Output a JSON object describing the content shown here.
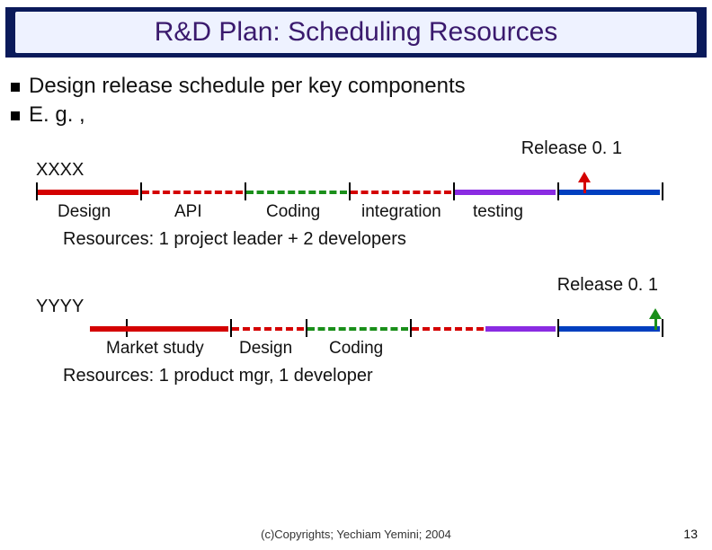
{
  "title": "R&D Plan: Scheduling Resources",
  "bullets": [
    "Design release schedule per key components",
    "E. g. ,"
  ],
  "timelines": [
    {
      "row_label": "XXXX",
      "release_label": "Release 0. 1",
      "segments": [
        {
          "label": "Design",
          "color": "#d40000",
          "style": "solid"
        },
        {
          "label": "API",
          "color": "#d40000",
          "style": "dash"
        },
        {
          "label": "Coding",
          "color": "#1a8f1a",
          "style": "dash"
        },
        {
          "label": "integration",
          "color": "#d40000",
          "style": "dash"
        },
        {
          "label": "testing",
          "color": "#8a2be2",
          "style": "solid"
        },
        {
          "label": "",
          "color": "#003fbf",
          "style": "solid"
        }
      ],
      "resources": "Resources: 1 project leader + 2 developers",
      "release_arrow_color": "#d40000"
    },
    {
      "row_label": "YYYY",
      "release_label": "Release 0. 1",
      "segments": [
        {
          "label": "Market study",
          "color": "#d40000",
          "style": "solid"
        },
        {
          "label": "Design",
          "color": "#d40000",
          "style": "dash"
        },
        {
          "label": "Coding",
          "color": "#1a8f1a",
          "style": "dash"
        },
        {
          "label": "",
          "color": "#d40000",
          "style": "dash"
        },
        {
          "label": "",
          "color": "#8a2be2",
          "style": "solid"
        },
        {
          "label": "",
          "color": "#003fbf",
          "style": "solid"
        }
      ],
      "resources": "Resources: 1 product mgr, 1 developer",
      "release_arrow_color": "#1a8f1a"
    }
  ],
  "footer": "(c)Copyrights; Yechiam Yemini; 2004",
  "page_number": "13",
  "chart_data": {
    "type": "table",
    "title": "R&D Plan: Scheduling Resources",
    "description": "Two Gantt-style schedules showing phases up to Release 0.1",
    "schedules": [
      {
        "track": "XXXX",
        "phases": [
          "Design",
          "API",
          "Coding",
          "integration",
          "testing"
        ],
        "milestone": "Release 0.1",
        "resources": "1 project leader + 2 developers"
      },
      {
        "track": "YYYY",
        "phases": [
          "Market study",
          "Design",
          "Coding"
        ],
        "milestone": "Release 0.1",
        "resources": "1 product mgr, 1 developer"
      }
    ]
  }
}
